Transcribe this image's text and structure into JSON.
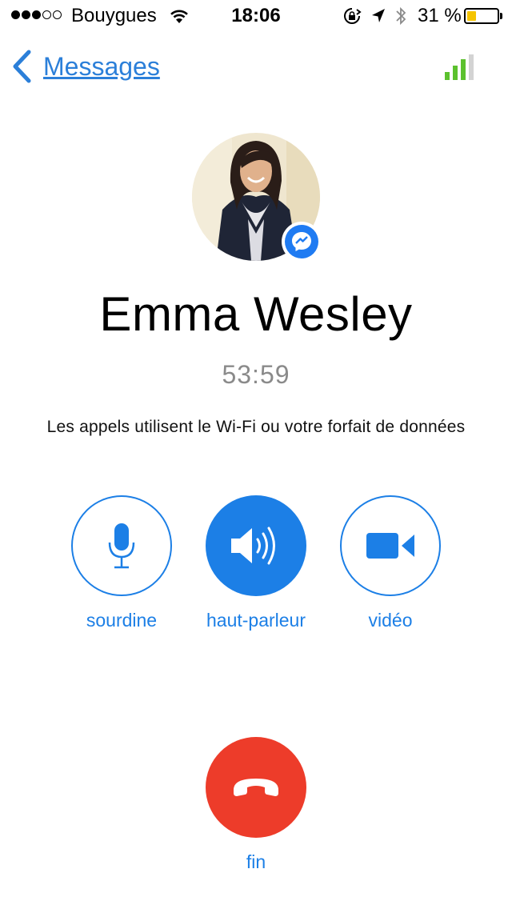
{
  "status_bar": {
    "carrier": "Bouygues",
    "signal_dots_filled": 3,
    "signal_dots_total": 5,
    "time": "18:06",
    "battery_percent": "31 %",
    "battery_level": 0.31,
    "battery_color": "#f5c400"
  },
  "nav": {
    "back_label": "Messages",
    "back_icon": "chevron-left-icon",
    "call_quality_icon": "signal-quality-icon"
  },
  "contact": {
    "name": "Emma Wesley",
    "badge_icon": "messenger-icon"
  },
  "call": {
    "duration": "53:59",
    "info": "Les appels utilisent le Wi-Fi ou votre forfait de données"
  },
  "controls": [
    {
      "label": "sourdine",
      "icon": "microphone-icon",
      "active": false
    },
    {
      "label": "haut-parleur",
      "icon": "speaker-icon",
      "active": true
    },
    {
      "label": "vidéo",
      "icon": "video-camera-icon",
      "active": false
    }
  ],
  "end_call": {
    "label": "fin",
    "icon": "hang-up-icon",
    "color": "#ed3c2a"
  },
  "colors": {
    "accent": "#1c7fe6",
    "link": "#2b7fd9",
    "quality_green": "#5cc12e"
  }
}
